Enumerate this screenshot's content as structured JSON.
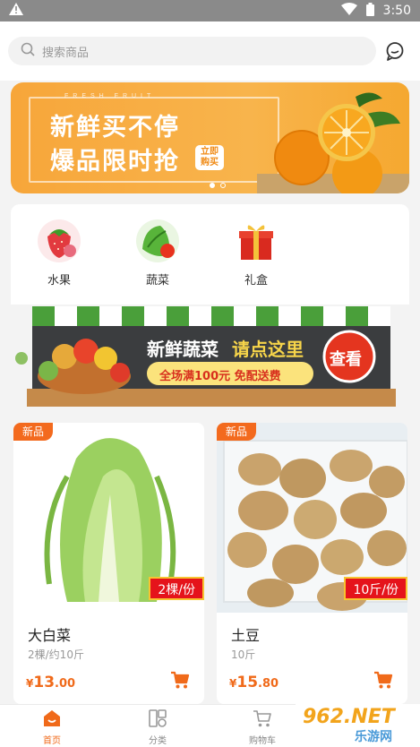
{
  "statusbar": {
    "time": "3:50"
  },
  "search": {
    "placeholder": "搜索商品"
  },
  "banner": {
    "tagline": "FRESH FRUIT",
    "line1": "新鲜买不停",
    "line2": "爆品限时抢",
    "buy_label_1": "立即",
    "buy_label_2": "购买"
  },
  "categories": [
    {
      "label": "水果",
      "icon": "strawberry-icon"
    },
    {
      "label": "蔬菜",
      "icon": "vegetable-icon"
    },
    {
      "label": "礼盒",
      "icon": "gift-box-icon"
    }
  ],
  "promo": {
    "title": "新鲜蔬菜",
    "highlight": "请点这里",
    "offer": "全场满100元 免配送费",
    "view_label": "查看"
  },
  "products": [
    {
      "badge": "新品",
      "unit": "2棵/份",
      "name": "大白菜",
      "spec": "2棵/约10斤",
      "currency": "¥",
      "price_int": "13",
      "price_dec": ".00"
    },
    {
      "badge": "新品",
      "unit": "10斤/份",
      "name": "土豆",
      "spec": "10斤",
      "currency": "¥",
      "price_int": "15",
      "price_dec": ".80"
    }
  ],
  "tabs": [
    {
      "label": "首页",
      "icon": "home-icon",
      "active": true
    },
    {
      "label": "分类",
      "icon": "category-icon",
      "active": false
    },
    {
      "label": "购物车",
      "icon": "cart-icon",
      "active": false
    }
  ],
  "watermark": {
    "brand": "962.NET",
    "sub": "乐游网"
  },
  "colors": {
    "accent": "#f06a1a",
    "banner": "#f7a63a",
    "badge_red": "#e5131b"
  }
}
